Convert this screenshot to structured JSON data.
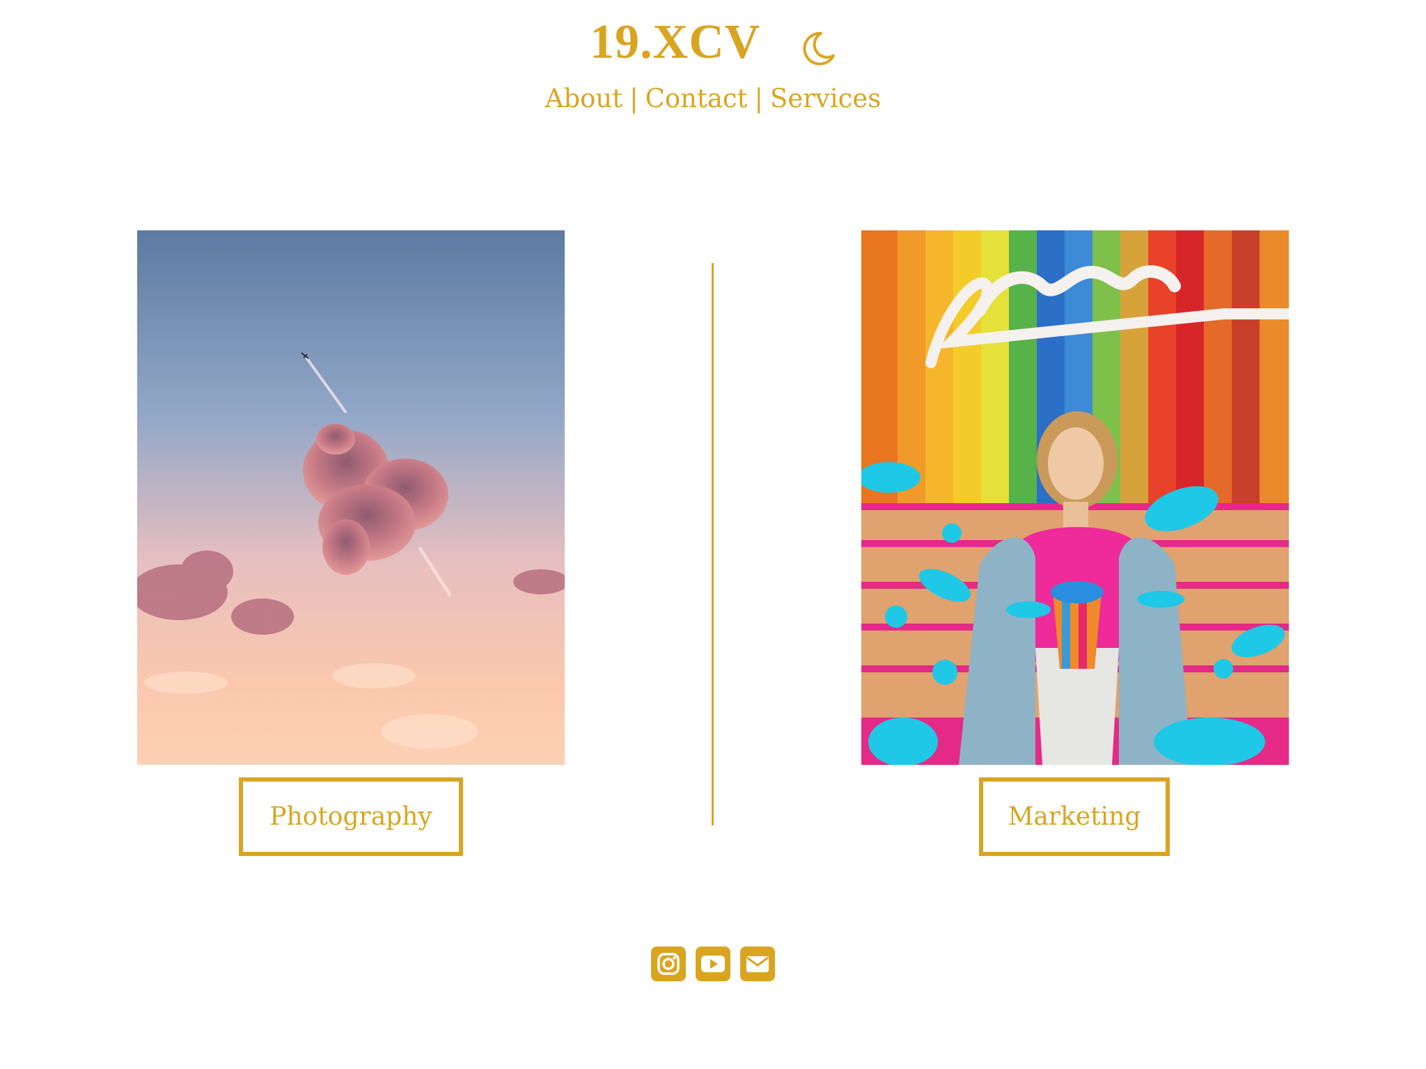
{
  "header": {
    "logo": "19.XCV",
    "theme_toggle_icon": "moon-icon",
    "nav": [
      {
        "label": "About"
      },
      {
        "label": "Contact"
      },
      {
        "label": "Services"
      }
    ],
    "nav_separator": "|"
  },
  "panels": [
    {
      "button_label": "Photography",
      "image": "sunset-sky-heart-cloud-photo"
    },
    {
      "button_label": "Marketing",
      "image": "candy-store-woman-photo"
    }
  ],
  "footer": {
    "social_icons": [
      "instagram-icon",
      "youtube-icon",
      "envelope-icon"
    ]
  },
  "colors": {
    "accent": "#d9a521",
    "background": "#ffffff"
  }
}
